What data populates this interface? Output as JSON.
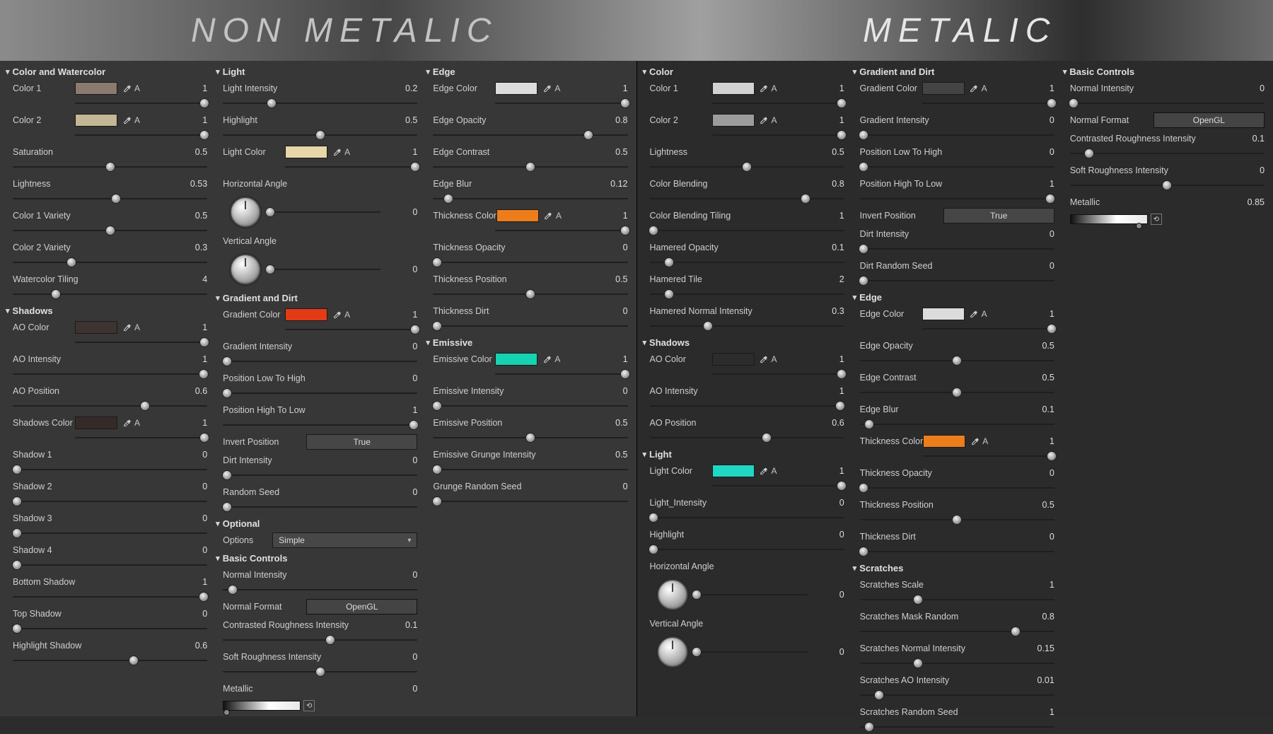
{
  "banner": {
    "left": "NON METALIC",
    "right": "METALIC"
  },
  "left": {
    "col1": [
      {
        "type": "header",
        "label": "Color and Watercolor"
      },
      {
        "type": "color",
        "label": "Color 1",
        "swatch": "#8a7a6f",
        "value": 1,
        "pos": 1
      },
      {
        "type": "color",
        "label": "Color 2",
        "swatch": "#c3b895",
        "value": 1,
        "pos": 1
      },
      {
        "type": "slider",
        "label": "Saturation",
        "value": 0.5,
        "pos": 0.5
      },
      {
        "type": "slider",
        "label": "Lightness",
        "value": 0.53,
        "pos": 0.53
      },
      {
        "type": "slider",
        "label": "Color 1 Variety",
        "value": 0.5,
        "pos": 0.5
      },
      {
        "type": "slider",
        "label": "Color 2 Variety",
        "value": 0.3,
        "pos": 0.3
      },
      {
        "type": "slider",
        "label": "Watercolor Tiling",
        "value": 4,
        "pos": 0.22
      },
      {
        "type": "header",
        "label": "Shadows"
      },
      {
        "type": "color",
        "label": "AO Color",
        "swatch": "#3d3330",
        "value": 1,
        "pos": 1
      },
      {
        "type": "slider",
        "label": "AO Intensity",
        "value": 1,
        "pos": 1
      },
      {
        "type": "slider",
        "label": "AO Position",
        "value": 0.6,
        "pos": 0.68
      },
      {
        "type": "color",
        "label": "Shadows Color",
        "swatch": "#342a28",
        "value": 1,
        "pos": 1
      },
      {
        "type": "slider",
        "label": "Shadow 1",
        "value": 0,
        "pos": 0
      },
      {
        "type": "slider",
        "label": "Shadow 2",
        "value": 0,
        "pos": 0
      },
      {
        "type": "slider",
        "label": "Shadow 3",
        "value": 0,
        "pos": 0
      },
      {
        "type": "slider",
        "label": "Shadow 4",
        "value": 0,
        "pos": 0
      },
      {
        "type": "slider",
        "label": "Bottom Shadow",
        "value": 1,
        "pos": 1
      },
      {
        "type": "slider",
        "label": "Top Shadow",
        "value": 0,
        "pos": 0
      },
      {
        "type": "slider",
        "label": "Highlight Shadow",
        "value": 0.6,
        "pos": 0.62
      }
    ],
    "col2": [
      {
        "type": "header",
        "label": "Light"
      },
      {
        "type": "slider",
        "label": "Light Intensity",
        "value": 0.2,
        "pos": 0.25
      },
      {
        "type": "slider",
        "label": "Highlight",
        "value": 0.5,
        "pos": 0.5
      },
      {
        "type": "color",
        "label": "Light Color",
        "swatch": "#e8d6a9",
        "value": 1,
        "pos": 1
      },
      {
        "type": "dial",
        "label": "Horizontal Angle",
        "value": 0,
        "pos": 0
      },
      {
        "type": "dial",
        "label": "Vertical Angle",
        "value": 0,
        "pos": 0
      },
      {
        "type": "header",
        "label": "Gradient and Dirt"
      },
      {
        "type": "color",
        "label": "Gradient Color",
        "swatch": "#e23b16",
        "value": 1,
        "pos": 1
      },
      {
        "type": "slider",
        "label": "Gradient Intensity",
        "value": 0,
        "pos": 0
      },
      {
        "type": "slider",
        "label": "Position Low To High",
        "value": 0,
        "pos": 0
      },
      {
        "type": "slider",
        "label": "Position High To Low",
        "value": 1,
        "pos": 1
      },
      {
        "type": "toggle",
        "label": "Invert Position",
        "value": "True"
      },
      {
        "type": "slider",
        "label": "Dirt Intensity",
        "value": 0,
        "pos": 0
      },
      {
        "type": "slider",
        "label": "Random Seed",
        "value": 0,
        "pos": 0
      },
      {
        "type": "header",
        "label": "Optional"
      },
      {
        "type": "dropdown",
        "label": "Options",
        "value": "Simple"
      },
      {
        "type": "header",
        "label": "Basic Controls"
      },
      {
        "type": "slider",
        "label": "Normal Intensity",
        "value": 0,
        "pos": 0.05
      },
      {
        "type": "inputbox",
        "label": "Normal Format",
        "value": "OpenGL"
      },
      {
        "type": "slider",
        "label": "Contrasted Roughness Intensity",
        "value": 0.1,
        "pos": 0.55
      },
      {
        "type": "slider",
        "label": "Soft Roughness Intensity",
        "value": 0,
        "pos": 0.5
      },
      {
        "type": "metallic",
        "label": "Metallic",
        "value": 0,
        "pos": 0
      }
    ],
    "col3": [
      {
        "type": "header",
        "label": "Edge"
      },
      {
        "type": "color",
        "label": "Edge Color",
        "swatch": "#dcdcdc",
        "value": 1,
        "pos": 1
      },
      {
        "type": "slider",
        "label": "Edge Opacity",
        "value": 0.8,
        "pos": 0.8
      },
      {
        "type": "slider",
        "label": "Edge Contrast",
        "value": 0.5,
        "pos": 0.5
      },
      {
        "type": "slider",
        "label": "Edge Blur",
        "value": 0.12,
        "pos": 0.08
      },
      {
        "type": "color",
        "label": "Thickness Color",
        "swatch": "#ed7d1b",
        "value": 1,
        "pos": 1
      },
      {
        "type": "slider",
        "label": "Thickness Opacity",
        "value": 0,
        "pos": 0
      },
      {
        "type": "slider",
        "label": "Thickness Position",
        "value": 0.5,
        "pos": 0.5
      },
      {
        "type": "slider",
        "label": "Thickness Dirt",
        "value": 0,
        "pos": 0
      },
      {
        "type": "header",
        "label": "Emissive"
      },
      {
        "type": "color",
        "label": "Emissive Color",
        "swatch": "#15d3b0",
        "value": 1,
        "pos": 1
      },
      {
        "type": "slider",
        "label": "Emissive Intensity",
        "value": 0,
        "pos": 0
      },
      {
        "type": "slider",
        "label": "Emissive Position",
        "value": 0.5,
        "pos": 0.5
      },
      {
        "type": "slider",
        "label": "Emissive Grunge Intensity",
        "value": 0.5,
        "pos": 0
      },
      {
        "type": "slider",
        "label": "Grunge Random Seed",
        "value": 0,
        "pos": 0
      }
    ]
  },
  "right": {
    "col1": [
      {
        "type": "header",
        "label": "Color"
      },
      {
        "type": "color",
        "label": "Color 1",
        "swatch": "#d2d2d2",
        "value": 1,
        "pos": 1
      },
      {
        "type": "color",
        "label": "Color 2",
        "swatch": "#9c9c9c",
        "value": 1,
        "pos": 1
      },
      {
        "type": "slider",
        "label": "Lightness",
        "value": 0.5,
        "pos": 0.5
      },
      {
        "type": "slider",
        "label": "Color Blending",
        "value": 0.8,
        "pos": 0.8
      },
      {
        "type": "slider",
        "label": "Color Blending Tiling",
        "value": 1,
        "pos": 0
      },
      {
        "type": "slider",
        "label": "Hamered Opacity",
        "value": 0.1,
        "pos": 0.1
      },
      {
        "type": "slider",
        "label": "Hamered Tile",
        "value": 2,
        "pos": 0.1
      },
      {
        "type": "slider",
        "label": "Hamered Normal Intensity",
        "value": 0.3,
        "pos": 0.3
      },
      {
        "type": "header",
        "label": "Shadows"
      },
      {
        "type": "color",
        "label": "AO Color",
        "swatch": "#2c2c2c",
        "value": 1,
        "pos": 1
      },
      {
        "type": "slider",
        "label": "AO Intensity",
        "value": 1,
        "pos": 1
      },
      {
        "type": "slider",
        "label": "AO Position",
        "value": 0.6,
        "pos": 0.6
      },
      {
        "type": "header",
        "label": "Light"
      },
      {
        "type": "color",
        "label": "Light Color",
        "swatch": "#1fd8c4",
        "value": 1,
        "pos": 1
      },
      {
        "type": "slider",
        "label": "Light_Intensity",
        "value": 0,
        "pos": 0
      },
      {
        "type": "slider",
        "label": "Highlight",
        "value": 0,
        "pos": 0
      },
      {
        "type": "dial",
        "label": "Horizontal Angle",
        "value": 0,
        "pos": 0
      },
      {
        "type": "dial",
        "label": "Vertical Angle",
        "value": 0,
        "pos": 0
      }
    ],
    "col2": [
      {
        "type": "header",
        "label": "Gradient and Dirt"
      },
      {
        "type": "color",
        "label": "Gradient Color",
        "swatch": "#444444",
        "value": 1,
        "pos": 1
      },
      {
        "type": "slider",
        "label": "Gradient Intensity",
        "value": 0,
        "pos": 0
      },
      {
        "type": "slider",
        "label": "Position Low To High",
        "value": 0,
        "pos": 0
      },
      {
        "type": "slider",
        "label": "Position High To Low",
        "value": 1,
        "pos": 1
      },
      {
        "type": "toggle",
        "label": "Invert Position",
        "value": "True"
      },
      {
        "type": "slider",
        "label": "Dirt Intensity",
        "value": 0,
        "pos": 0
      },
      {
        "type": "slider",
        "label": "Dirt Random Seed",
        "value": 0,
        "pos": 0
      },
      {
        "type": "header",
        "label": "Edge"
      },
      {
        "type": "color",
        "label": "Edge Color",
        "swatch": "#dcdcdc",
        "value": 1,
        "pos": 1
      },
      {
        "type": "slider",
        "label": "Edge Opacity",
        "value": 0.5,
        "pos": 0.5
      },
      {
        "type": "slider",
        "label": "Edge Contrast",
        "value": 0.5,
        "pos": 0.5
      },
      {
        "type": "slider",
        "label": "Edge Blur",
        "value": 0.1,
        "pos": 0.05
      },
      {
        "type": "color",
        "label": "Thickness Color",
        "swatch": "#ed7d1b",
        "value": 1,
        "pos": 1
      },
      {
        "type": "slider",
        "label": "Thickness Opacity",
        "value": 0,
        "pos": 0
      },
      {
        "type": "slider",
        "label": "Thickness Position",
        "value": 0.5,
        "pos": 0.5
      },
      {
        "type": "slider",
        "label": "Thickness Dirt",
        "value": 0,
        "pos": 0
      },
      {
        "type": "header",
        "label": "Scratches"
      },
      {
        "type": "slider",
        "label": "Scratches Scale",
        "value": 1,
        "pos": 0.3
      },
      {
        "type": "slider",
        "label": "Scratches Mask Random",
        "value": 0.8,
        "pos": 0.8
      },
      {
        "type": "slider",
        "label": "Scratches Normal Intensity",
        "value": 0.15,
        "pos": 0.3
      },
      {
        "type": "slider",
        "label": "Scratches AO Intensity",
        "value": 0.01,
        "pos": 0.1
      },
      {
        "type": "slider",
        "label": "Scratches Random Seed",
        "value": 1,
        "pos": 0.05
      }
    ],
    "col3": [
      {
        "type": "header",
        "label": "Basic Controls"
      },
      {
        "type": "slider",
        "label": "Normal Intensity",
        "value": 0,
        "pos": 0
      },
      {
        "type": "inputbox",
        "label": "Normal Format",
        "value": "OpenGL"
      },
      {
        "type": "slider",
        "label": "Contrasted Roughness Intensity",
        "value": 0.1,
        "pos": 0.1
      },
      {
        "type": "slider",
        "label": "Soft Roughness Intensity",
        "value": 0,
        "pos": 0.5
      },
      {
        "type": "metallic",
        "label": "Metallic",
        "value": 0.85,
        "pos": 0.85
      }
    ]
  }
}
